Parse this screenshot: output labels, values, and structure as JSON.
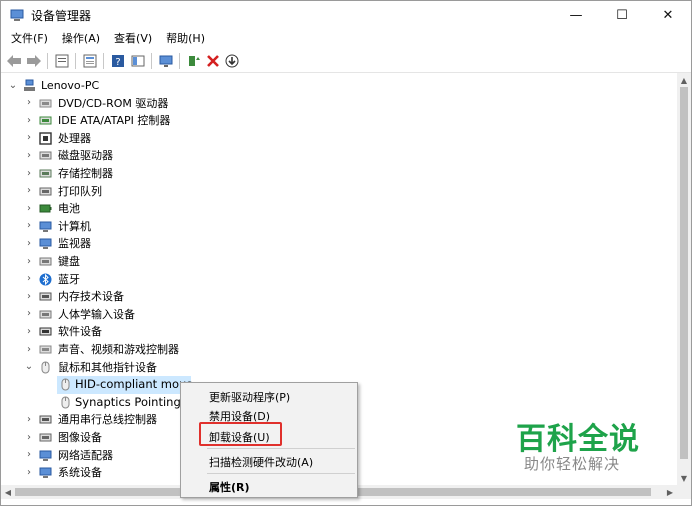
{
  "window": {
    "title": "设备管理器",
    "minimize_glyph": "—",
    "maximize_glyph": "☐",
    "close_glyph": "✕"
  },
  "menu": {
    "items": [
      "文件(F)",
      "操作(A)",
      "查看(V)",
      "帮助(H)"
    ]
  },
  "toolbar": {
    "icons": [
      "back-arrow-icon",
      "forward-arrow-icon",
      "properties-icon",
      "show-hidden-icon",
      "help-icon",
      "view-icon",
      "monitor-icon",
      "update-driver-icon",
      "uninstall-icon",
      "scan-icon"
    ]
  },
  "tree": {
    "root": "Lenovo-PC",
    "items": [
      {
        "label": "DVD/CD-ROM 驱动器",
        "icon": "dvd-drive-icon",
        "expanded": false
      },
      {
        "label": "IDE ATA/ATAPI 控制器",
        "icon": "ide-controller-icon",
        "expanded": false
      },
      {
        "label": "处理器",
        "icon": "processor-icon",
        "expanded": false
      },
      {
        "label": "磁盘驱动器",
        "icon": "disk-drive-icon",
        "expanded": false
      },
      {
        "label": "存储控制器",
        "icon": "storage-controller-icon",
        "expanded": false
      },
      {
        "label": "打印队列",
        "icon": "printer-icon",
        "expanded": false
      },
      {
        "label": "电池",
        "icon": "battery-icon",
        "expanded": false
      },
      {
        "label": "计算机",
        "icon": "computer-icon",
        "expanded": false
      },
      {
        "label": "监视器",
        "icon": "monitor-icon",
        "expanded": false
      },
      {
        "label": "键盘",
        "icon": "keyboard-icon",
        "expanded": false
      },
      {
        "label": "蓝牙",
        "icon": "bluetooth-icon",
        "expanded": false
      },
      {
        "label": "内存技术设备",
        "icon": "memory-device-icon",
        "expanded": false
      },
      {
        "label": "人体学输入设备",
        "icon": "hid-icon",
        "expanded": false
      },
      {
        "label": "软件设备",
        "icon": "software-device-icon",
        "expanded": false
      },
      {
        "label": "声音、视频和游戏控制器",
        "icon": "audio-icon",
        "expanded": false
      },
      {
        "label": "鼠标和其他指针设备",
        "icon": "mouse-icon",
        "expanded": true
      },
      {
        "label": "HID-compliant mous",
        "icon": "mouse-icon",
        "child": true,
        "selected": true
      },
      {
        "label": "Synaptics Pointing D",
        "icon": "mouse-icon",
        "child": true
      },
      {
        "label": "通用串行总线控制器",
        "icon": "usb-icon",
        "expanded": false
      },
      {
        "label": "图像设备",
        "icon": "camera-icon",
        "expanded": false
      },
      {
        "label": "网络适配器",
        "icon": "network-adapter-icon",
        "expanded": false
      },
      {
        "label": "系统设备",
        "icon": "system-device-icon",
        "expanded": false
      }
    ]
  },
  "context_menu": {
    "items": [
      "更新驱动程序(P)",
      "禁用设备(D)",
      "卸载设备(U)",
      "扫描检测硬件改动(A)",
      "属性(R)"
    ]
  },
  "watermark": {
    "title": "百科全说",
    "subtitle": "助你轻松解决"
  },
  "colors": {
    "selection": "#cce8ff",
    "highlight_box": "#e0302c",
    "watermark_green": "#1ea34a"
  }
}
